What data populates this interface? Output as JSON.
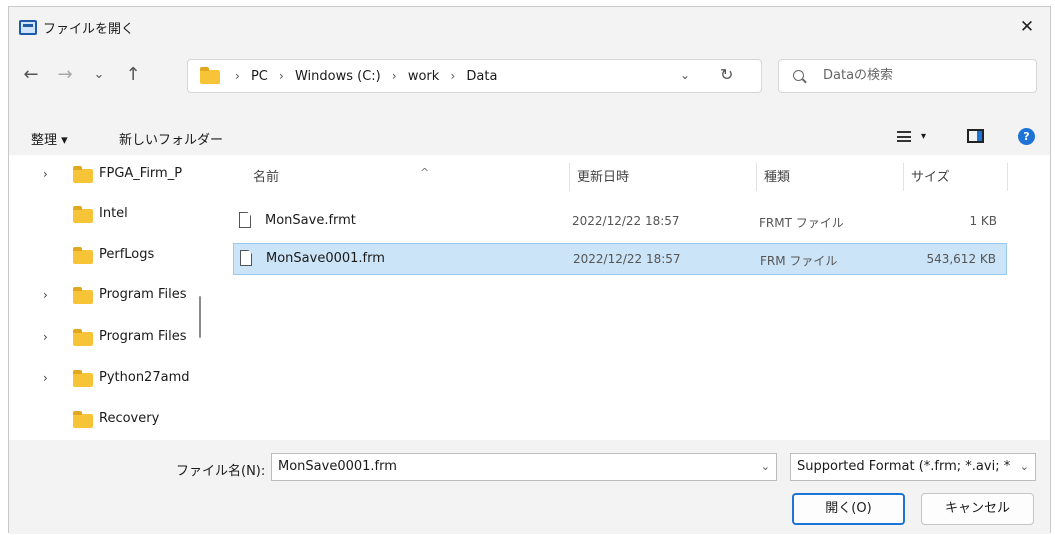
{
  "window": {
    "title": "ファイルを開く"
  },
  "navigation": {
    "back": "←",
    "forward": "→",
    "recent": "⌄",
    "up": "↑",
    "breadcrumbs": [
      "PC",
      "Windows (C:)",
      "work",
      "Data"
    ],
    "separator": "›",
    "address_dropdown": "⌄",
    "refresh": "↻"
  },
  "search": {
    "placeholder": "Dataの検索"
  },
  "toolbar": {
    "organize": "整理 ▾",
    "new_folder": "新しいフォルダー",
    "view_caret": "▾",
    "help": "?"
  },
  "nav_pane": {
    "items": [
      {
        "label": "FPGA_Firm_P",
        "expandable": true
      },
      {
        "label": "Intel",
        "expandable": false
      },
      {
        "label": "PerfLogs",
        "expandable": false
      },
      {
        "label": "Program Files",
        "expandable": true
      },
      {
        "label": "Program Files",
        "expandable": true
      },
      {
        "label": "Python27amd",
        "expandable": true
      },
      {
        "label": "Recovery",
        "expandable": false
      }
    ],
    "chevron": "›"
  },
  "file_list": {
    "columns": {
      "name": "名前",
      "date": "更新日時",
      "type": "種類",
      "size": "サイズ"
    },
    "sort_indicator": "^",
    "rows": [
      {
        "name": "MonSave.frmt",
        "date": "2022/12/22 18:57",
        "type": "FRMT ファイル",
        "size": "1 KB",
        "selected": false
      },
      {
        "name": "MonSave0001.frm",
        "date": "2022/12/22 18:57",
        "type": "FRM ファイル",
        "size": "543,612 KB",
        "selected": true
      }
    ]
  },
  "bottom": {
    "filename_label": "ファイル名(N):",
    "filename_value": "MonSave0001.frm",
    "filter_value": "Supported Format (*.frm; *.avi; *",
    "dropdown": "⌄",
    "open_button": "開く(O)",
    "cancel_button": "キャンセル"
  },
  "colors": {
    "selection": "#cce4f7",
    "accent": "#1e74d6",
    "folder": "#f7c437"
  }
}
